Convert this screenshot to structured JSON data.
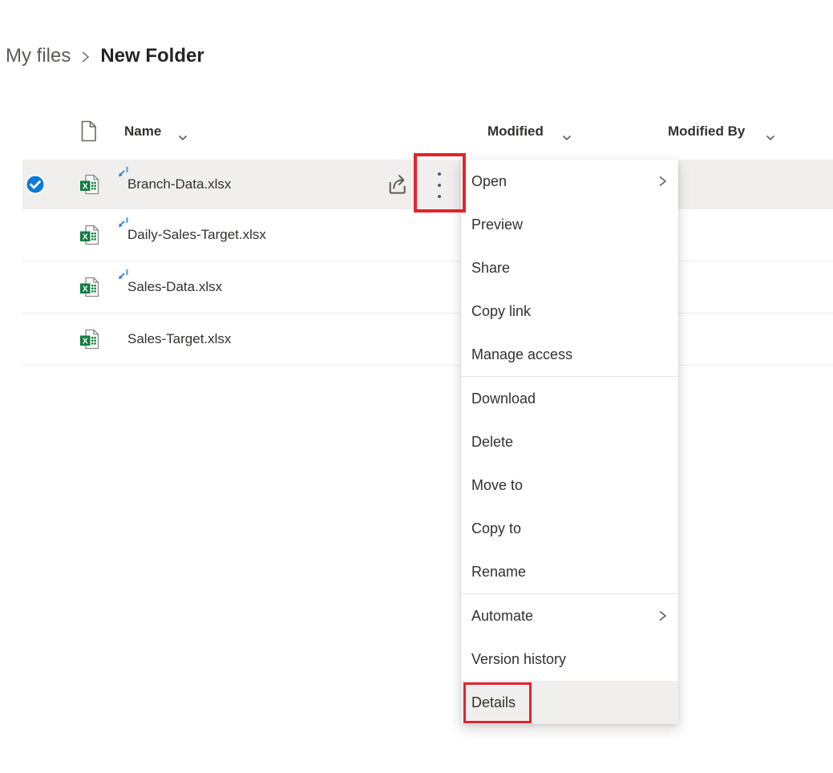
{
  "breadcrumb": {
    "items": [
      {
        "label": "My files"
      },
      {
        "label": "New Folder"
      }
    ],
    "separator": ">"
  },
  "table": {
    "columns": [
      {
        "label": "Name"
      },
      {
        "label": "Modified"
      },
      {
        "label": "Modified By"
      }
    ],
    "rows": [
      {
        "name": "Branch-Data.xlsx",
        "selected": true,
        "new_badge": true,
        "file_type": "xlsx"
      },
      {
        "name": "Daily-Sales-Target.xlsx",
        "selected": false,
        "new_badge": true,
        "file_type": "xlsx"
      },
      {
        "name": "Sales-Data.xlsx",
        "selected": false,
        "new_badge": true,
        "file_type": "xlsx"
      },
      {
        "name": "Sales-Target.xlsx",
        "selected": false,
        "new_badge": false,
        "file_type": "xlsx"
      }
    ]
  },
  "context_menu": {
    "sections": [
      {
        "items": [
          {
            "label": "Open",
            "submenu": true
          },
          {
            "label": "Preview"
          },
          {
            "label": "Share"
          },
          {
            "label": "Copy link"
          },
          {
            "label": "Manage access"
          }
        ]
      },
      {
        "items": [
          {
            "label": "Download"
          },
          {
            "label": "Delete"
          },
          {
            "label": "Move to"
          },
          {
            "label": "Copy to"
          },
          {
            "label": "Rename"
          }
        ]
      },
      {
        "items": [
          {
            "label": "Automate",
            "submenu": true
          },
          {
            "label": "Version history"
          },
          {
            "label": "Details",
            "highlighted": true
          }
        ]
      }
    ]
  },
  "icons": {
    "header_file": "document-icon",
    "sort": "chevron-down-icon",
    "selected": "check-circle-icon",
    "file_type": "excel-file-icon",
    "new_badge": "recently-added-icon",
    "share": "share-icon",
    "more": "more-actions-ellipsis-icon",
    "submenu": "chevron-right-icon"
  },
  "colors": {
    "accent_blue": "#0b7bd8",
    "excel_green": "#107c41",
    "annotation_red": "#e0242e",
    "selected_row_bg": "#f1efed",
    "text_primary": "#323130",
    "text_secondary": "#5d5a58"
  }
}
